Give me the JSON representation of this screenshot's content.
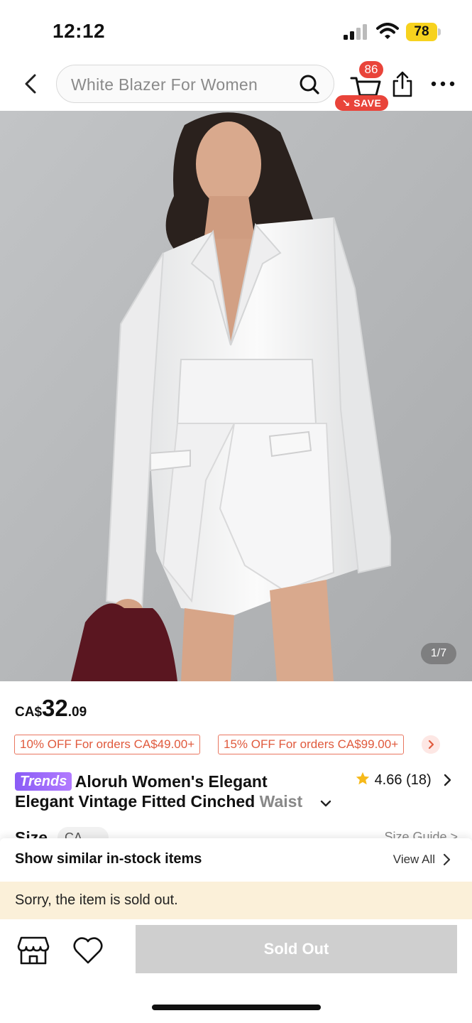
{
  "status_bar": {
    "time": "12:12",
    "battery": "78"
  },
  "header": {
    "search_placeholder": "White Blazer For Women",
    "cart_count": "86",
    "save_label": "SAVE"
  },
  "gallery": {
    "counter": "1/7"
  },
  "price": {
    "currency": "CA$",
    "integer": "32",
    "decimal": ".09"
  },
  "coupons": [
    "10% OFF For orders CA$49.00+",
    "15% OFF For orders CA$99.00+"
  ],
  "product": {
    "badge": "Trends",
    "title_line1": "Aloruh Women's Elegant",
    "title_line2": "Elegant Vintage Fitted Cinched ",
    "title_line2_fade": "Waist",
    "rating": "4.66",
    "rating_count": "(18)"
  },
  "size": {
    "label": "Size",
    "selected": "CA",
    "guide": "Size Guide >"
  },
  "sheet": {
    "similar_label": "Show similar in-stock items",
    "view_all": "View All",
    "sold_message": "Sorry, the item is sold out.",
    "sold_button": "Sold Out"
  },
  "colors": {
    "accent": "#e9443a",
    "coupon": "#e05a3d",
    "sold_bg": "#fbf0d9",
    "disabled": "#cfcfcf"
  }
}
